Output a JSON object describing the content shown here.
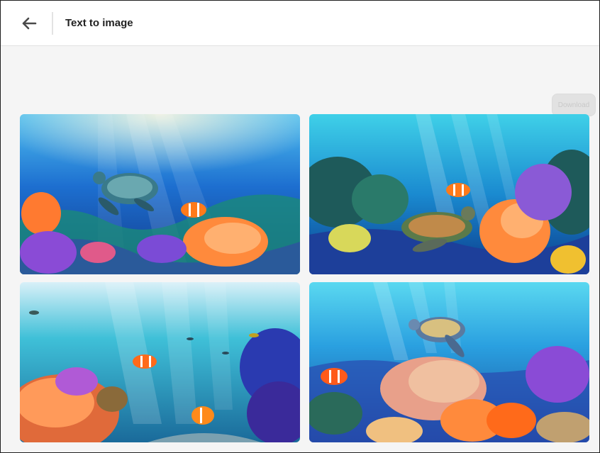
{
  "header": {
    "title": "Text to image",
    "back_icon": "arrow-left-icon"
  },
  "actions": {
    "download_label": "Download"
  },
  "colors": {
    "header_bg": "#ffffff",
    "page_bg": "#f5f5f5",
    "deep_water": "#0b3a8a",
    "light_water": "#3fd0e8",
    "coral_orange": "#ff8a3c",
    "coral_purple": "#7b4bd6"
  },
  "gallery": {
    "images": [
      {
        "subject": "sea turtle swimming over coral reef with clownfish"
      },
      {
        "subject": "sea turtle resting on reef with clownfish and orange coral"
      },
      {
        "subject": "coral reef with clownfish and small fish"
      },
      {
        "subject": "sea turtle above colorful coral reef with clownfish"
      }
    ]
  }
}
